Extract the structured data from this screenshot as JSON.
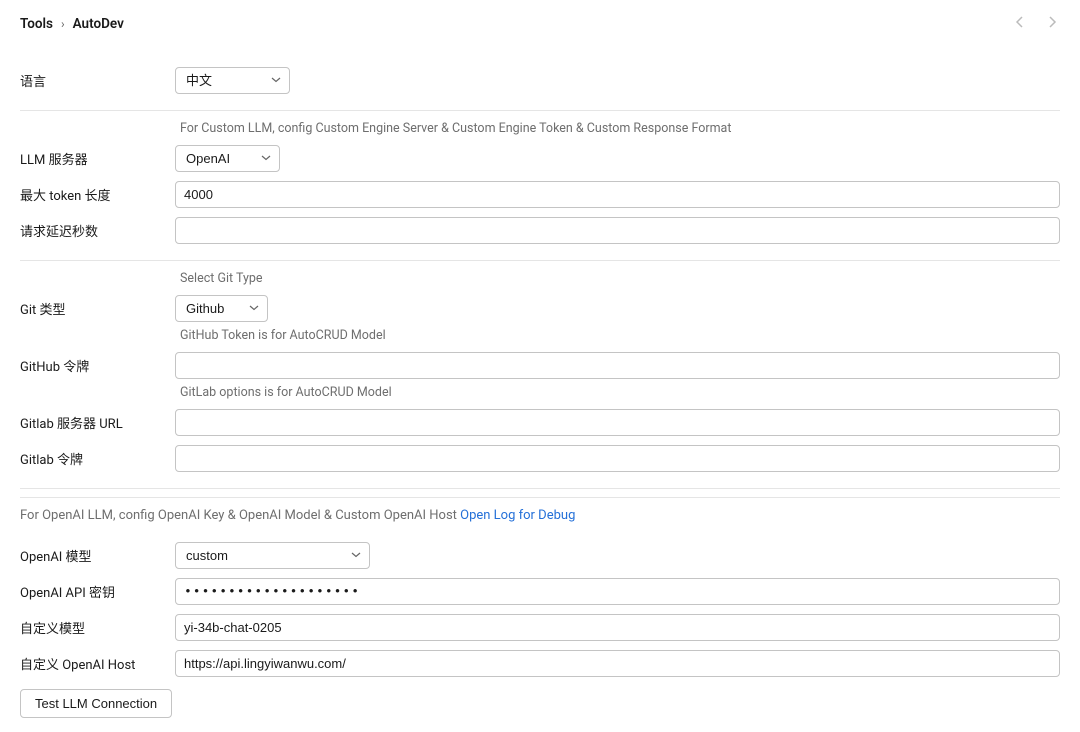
{
  "breadcrumb": {
    "parent": "Tools",
    "sep": "›",
    "current": "AutoDev"
  },
  "section_lang": {
    "label": "语言",
    "value": "中文"
  },
  "section_llm": {
    "hint": "For Custom LLM, config Custom Engine Server & Custom Engine Token & Custom Response Format",
    "server_label": "LLM 服务器",
    "server_value": "OpenAI",
    "max_token_label": "最大 token 长度",
    "max_token_value": "4000",
    "delay_label": "请求延迟秒数",
    "delay_value": ""
  },
  "section_git": {
    "hint_type": "Select Git Type",
    "type_label": "Git 类型",
    "type_value": "Github",
    "hint_github": "GitHub Token is for AutoCRUD Model",
    "github_token_label": "GitHub 令牌",
    "github_token_value": "",
    "hint_gitlab": "GitLab options is for AutoCRUD Model",
    "gitlab_url_label": "Gitlab 服务器 URL",
    "gitlab_url_value": "",
    "gitlab_token_label": "Gitlab 令牌",
    "gitlab_token_value": ""
  },
  "section_openai": {
    "info_prefix": "For OpenAI LLM, config OpenAI Key & OpenAI Model & Custom OpenAI Host ",
    "info_link": "Open Log for Debug",
    "model_label": "OpenAI 模型",
    "model_value": "custom",
    "api_key_label": "OpenAI API 密钥",
    "api_key_value": "••••••••••••••••••••",
    "custom_model_label": "自定义模型",
    "custom_model_value": "yi-34b-chat-0205",
    "custom_host_label": "自定义 OpenAI Host",
    "custom_host_value": "https://api.lingyiwanwu.com/"
  },
  "test_button": "Test LLM Connection"
}
